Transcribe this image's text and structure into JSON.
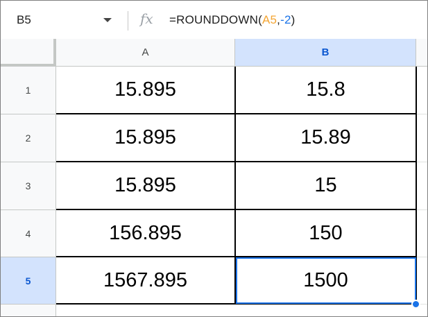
{
  "formula_bar": {
    "name_box": "B5",
    "fx_label": "fx",
    "formula_prefix": "=ROUNDDOWN(",
    "formula_ref": "A5",
    "formula_comma": ",",
    "formula_num": "-2",
    "formula_suffix": ")"
  },
  "columns": [
    {
      "label": "A",
      "selected": false
    },
    {
      "label": "B",
      "selected": true
    }
  ],
  "rows": [
    {
      "num": "1",
      "a": "15.895",
      "b": "15.8"
    },
    {
      "num": "2",
      "a": "15.895",
      "b": "15.89"
    },
    {
      "num": "3",
      "a": "15.895",
      "b": "15"
    },
    {
      "num": "4",
      "a": "156.895",
      "b": "150"
    },
    {
      "num": "5",
      "a": "1567.895",
      "b": "1500"
    }
  ],
  "active_cell": "B5",
  "colors": {
    "selection": "#1a73e8",
    "header_selected_bg": "#d3e3fd",
    "formula_ref": "#f4a533",
    "formula_number": "#1a73e8"
  }
}
